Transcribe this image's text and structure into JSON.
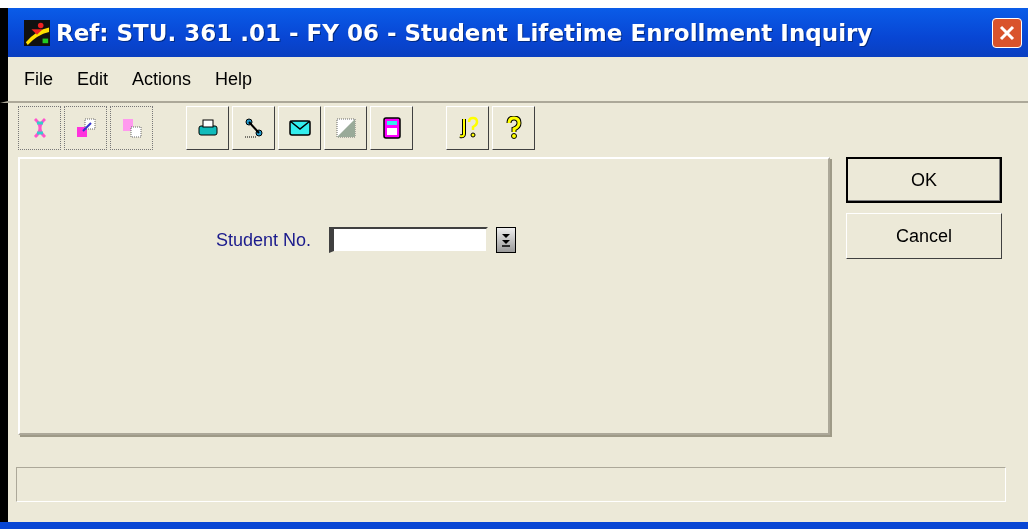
{
  "window": {
    "title": "Ref: STU. 361 .01 - FY 06 - Student Lifetime Enrollment Inquiry"
  },
  "menu": [
    "File",
    "Edit",
    "Actions",
    "Help"
  ],
  "form": {
    "label": "Student No."
  },
  "buttons": [
    {
      "label": "OK",
      "default": true
    },
    {
      "label": "Cancel",
      "default": false
    }
  ]
}
